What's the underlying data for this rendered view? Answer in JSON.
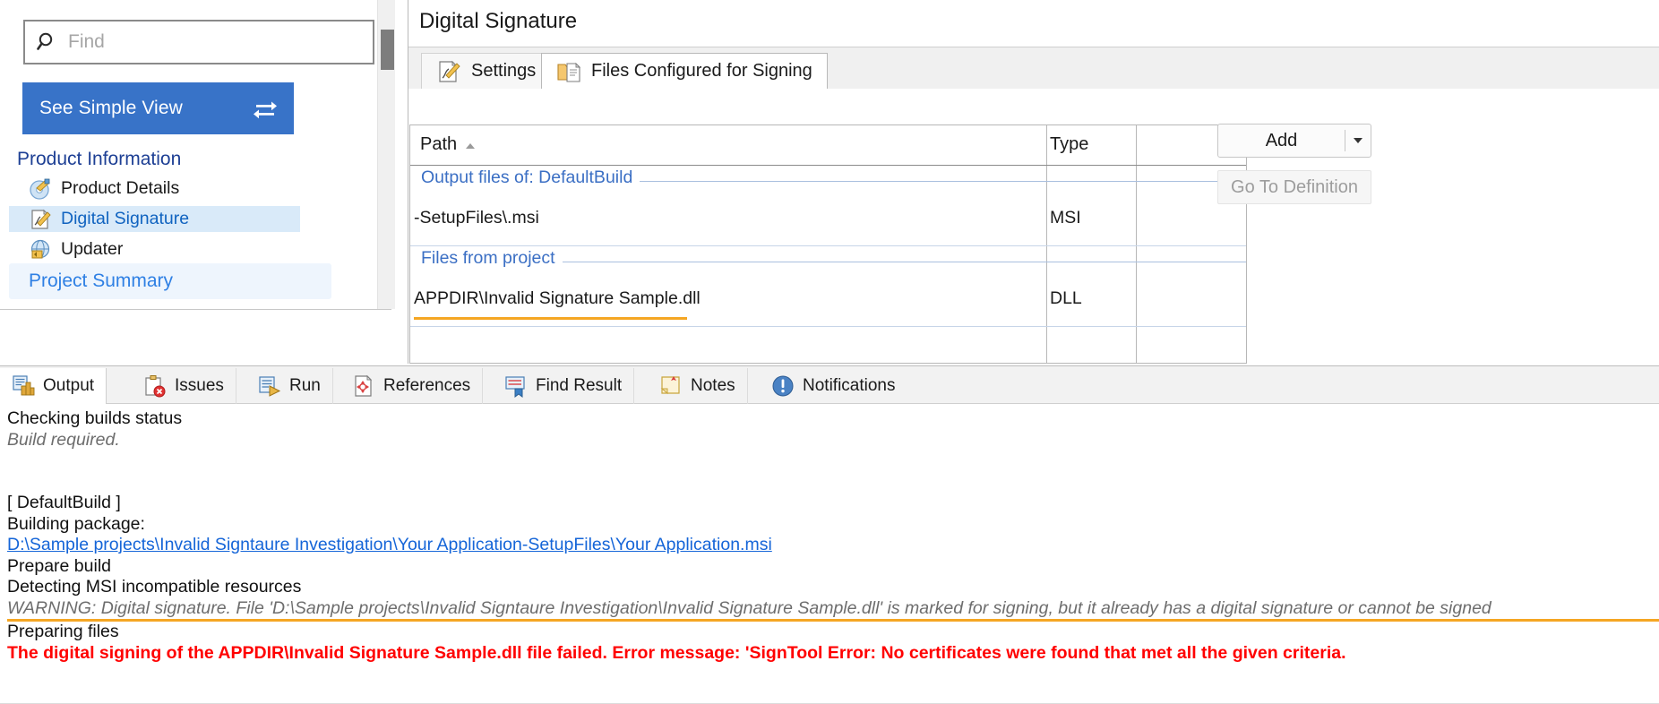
{
  "sidebar": {
    "search": {
      "placeholder": "Find",
      "value": "",
      "icon": "search-icon"
    },
    "simple_view": {
      "label": "See Simple View",
      "icon": "swap-arrows-icon",
      "bg_color": "#3873c8"
    },
    "section_header": "Product Information",
    "items": [
      {
        "label": "Product Details",
        "icon": "product-details-icon",
        "selected": false
      },
      {
        "label": "Digital Signature",
        "icon": "digital-signature-icon",
        "selected": true
      },
      {
        "label": "Updater",
        "icon": "updater-globe-icon",
        "selected": false
      }
    ],
    "project_summary": {
      "label": "Project Summary"
    }
  },
  "main": {
    "title": "Digital Signature",
    "tabs": [
      {
        "label": "Settings",
        "icon": "settings-pencil-icon",
        "active": false
      },
      {
        "label": "Files Configured for Signing",
        "icon": "folder-document-icon",
        "active": true
      }
    ],
    "grid": {
      "columns": [
        {
          "label": "Path",
          "sorted": true,
          "sort_direction": "asc"
        },
        {
          "label": "Type",
          "sorted": false
        }
      ],
      "groups": [
        {
          "label": "Output files of: DefaultBuild",
          "rows": [
            {
              "path": "-SetupFiles\\.msi",
              "type": "MSI",
              "error": false
            }
          ]
        },
        {
          "label": "Files from project",
          "rows": [
            {
              "path": "APPDIR\\Invalid Signature Sample.dll",
              "type": "DLL",
              "error": true
            }
          ]
        }
      ]
    },
    "buttons": {
      "add": {
        "label": "Add",
        "enabled": true,
        "has_dropdown": true
      },
      "go_to_definition": {
        "label": "Go To Definition",
        "enabled": false
      }
    }
  },
  "bottom": {
    "tabs": [
      {
        "label": "Output",
        "icon": "output-icon",
        "active": true
      },
      {
        "label": "Issues",
        "icon": "issues-icon",
        "active": false
      },
      {
        "label": "Run",
        "icon": "run-icon",
        "active": false
      },
      {
        "label": "References",
        "icon": "references-icon",
        "active": false
      },
      {
        "label": "Find Result",
        "icon": "find-result-icon",
        "active": false
      },
      {
        "label": "Notes",
        "icon": "notes-icon",
        "active": false
      },
      {
        "label": "Notifications",
        "icon": "notifications-icon",
        "active": false
      }
    ],
    "log": [
      {
        "text": "Checking builds status",
        "style": "normal"
      },
      {
        "text": "Build required.",
        "style": "italic-gray"
      },
      {
        "text": "",
        "style": "blank"
      },
      {
        "text": "",
        "style": "blank"
      },
      {
        "text": "[ DefaultBuild ]",
        "style": "normal"
      },
      {
        "text": "Building package:",
        "style": "normal"
      },
      {
        "text": "D:\\Sample projects\\Invalid Signtaure Investigation\\Your Application-SetupFiles\\Your Application.msi",
        "style": "link"
      },
      {
        "text": "Prepare build",
        "style": "normal"
      },
      {
        "text": "Detecting MSI incompatible resources",
        "style": "normal"
      },
      {
        "text": "WARNING: Digital signature. File 'D:\\Sample projects\\Invalid Signtaure Investigation\\Invalid Signature Sample.dll' is marked for signing, but it already has a digital signature or cannot be signed",
        "style": "warning"
      },
      {
        "text": "Preparing files",
        "style": "normal"
      },
      {
        "text": "The digital signing of the APPDIR\\Invalid Signature Sample.dll file failed. Error message: 'SignTool Error: No certificates were found that met all the given criteria.",
        "style": "error"
      }
    ]
  },
  "colors": {
    "accent_blue": "#3873c8",
    "link_blue": "#1565d8",
    "selection_blue": "#d9eaf9",
    "warning_orange": "#f5a623",
    "error_red": "#ff0000",
    "header_navy": "#1d3f94"
  }
}
